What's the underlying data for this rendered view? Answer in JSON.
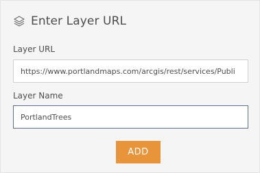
{
  "dialog": {
    "title": "Enter Layer URL",
    "icon": "layers-icon"
  },
  "layer_url": {
    "label": "Layer URL",
    "value": "https://www.portlandmaps.com/arcgis/rest/services/Publi"
  },
  "layer_name": {
    "label": "Layer Name",
    "value": "PortlandTrees"
  },
  "actions": {
    "add_label": "ADD"
  },
  "colors": {
    "add_button": "#e8943a",
    "panel_background": "#f5f5f5",
    "focused_border": "#5a6e8c"
  }
}
